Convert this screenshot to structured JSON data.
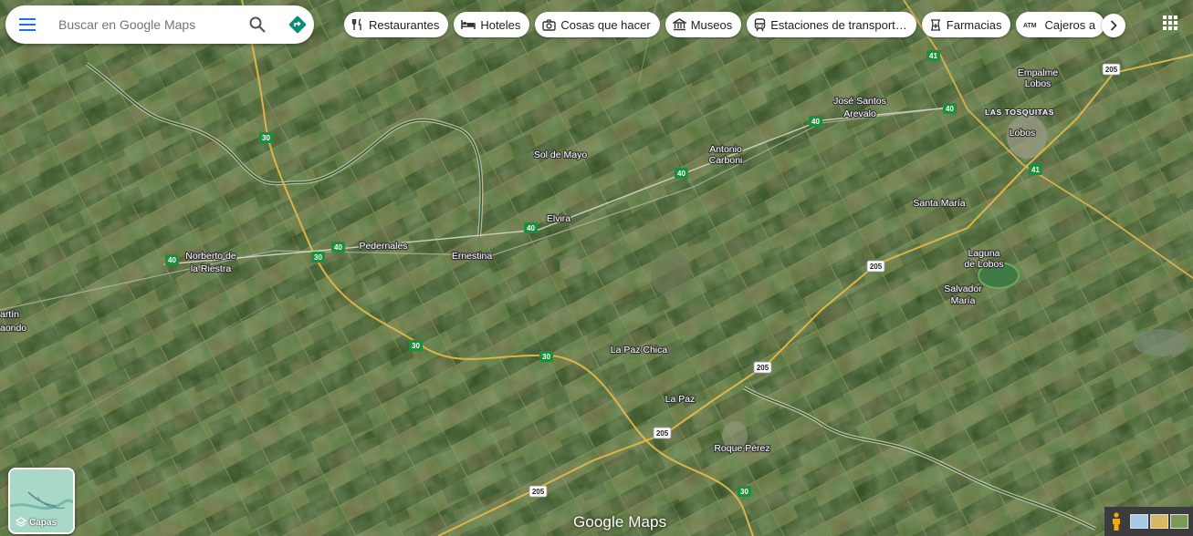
{
  "search": {
    "placeholder": "Buscar en Google Maps"
  },
  "icons": {
    "menu": "menu-icon",
    "search": "search-icon",
    "directions": "directions-icon",
    "apps": "apps-grid-icon",
    "layers": "layers-icon",
    "pegman": "pegman-icon"
  },
  "chips": [
    {
      "label": "Restaurantes",
      "icon": "restaurant-icon"
    },
    {
      "label": "Hoteles",
      "icon": "hotel-icon"
    },
    {
      "label": "Cosas que hacer",
      "icon": "camera-icon"
    },
    {
      "label": "Museos",
      "icon": "museum-icon"
    },
    {
      "label": "Estaciones de transport…",
      "icon": "transit-icon"
    },
    {
      "label": "Farmacias",
      "icon": "pharmacy-icon"
    },
    {
      "label": "Cajeros a",
      "icon": "atm-icon"
    }
  ],
  "chip_icon_text": {
    "atm": "ATM"
  },
  "layers": {
    "label": "Capas"
  },
  "logo": {
    "text": "Google Maps"
  },
  "places": {
    "empalme_lobos_1": "Empalme",
    "empalme_lobos_2": "Lobos",
    "jose_santos_arevalo_1": "José Santos",
    "jose_santos_arevalo_2": "Arevalo",
    "las_tosquitas": "LAS TOSQUITAS",
    "lobos": "Lobos",
    "antonio_carboni_1": "Antonio",
    "antonio_carboni_2": "Carboni",
    "sol_de_mayo": "Sol de Mayo",
    "santa_maria": "Santa María",
    "elvira": "Elvira",
    "laguna_de_lobos_1": "Laguna",
    "laguna_de_lobos_2": "de Lobos",
    "norberto_1": "Norberto de",
    "norberto_2": "la Riestra",
    "pedernales": "Pedernales",
    "ernestina": "Ernestina",
    "salvador_maria_1": "Salvador",
    "salvador_maria_2": "María",
    "martin_1": "artín",
    "martin_2": "aondo",
    "la_paz_chica": "La Paz Chica",
    "la_paz": "La Paz",
    "roque_perez": "Roque Pérez"
  },
  "route_shields": {
    "r30_a": "30",
    "r30_b": "30",
    "r30_c": "30",
    "r30_d": "30",
    "r30_e": "30",
    "r40_a": "40",
    "r40_b": "40",
    "r40_c": "40",
    "r40_d": "40",
    "r40_e": "40",
    "r40_f": "40",
    "r41_a": "41",
    "r41_b": "41",
    "r205_a": "205",
    "r205_b": "205",
    "r205_c": "205",
    "r205_d": "205",
    "r205_e": "205"
  },
  "colors": {
    "satellite_base": "#4f6a38",
    "route_shield_green": "#1e8e3e",
    "accent_blue": "#1a73e8",
    "directions_teal": "#0b8a7a"
  }
}
